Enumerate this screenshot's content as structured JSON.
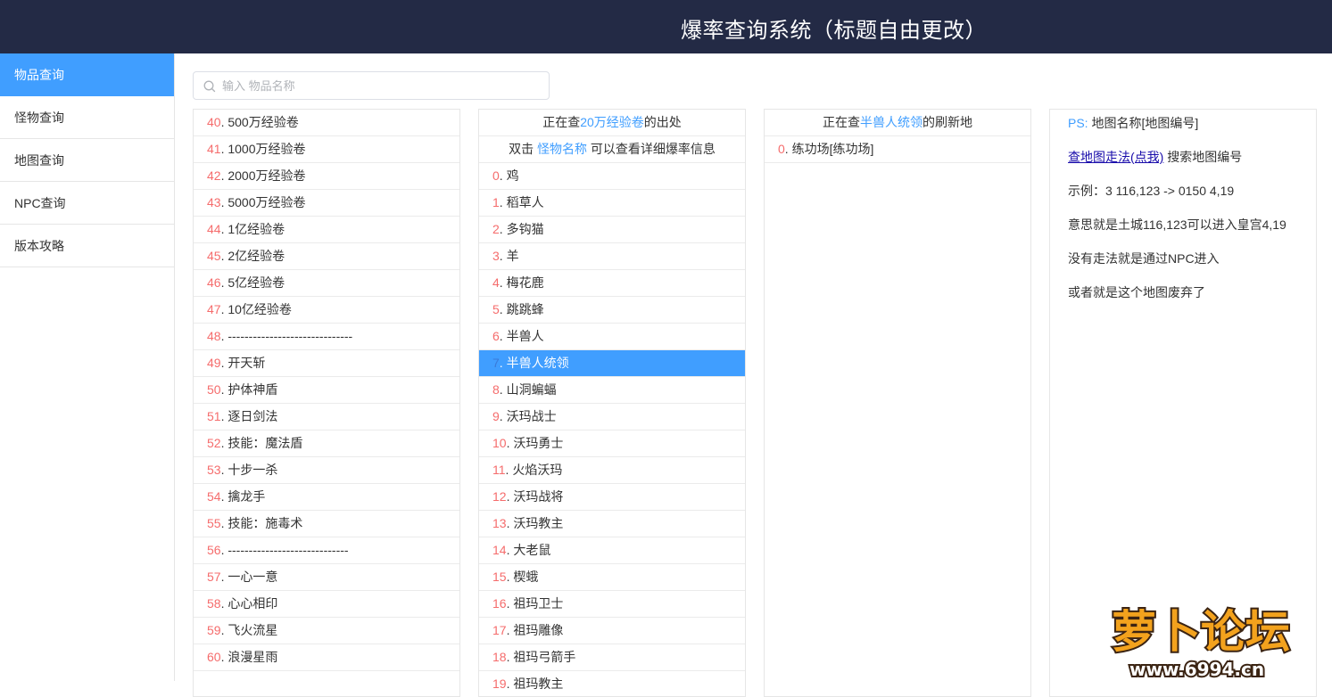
{
  "header": {
    "title": "爆率查询系统（标题自由更改）"
  },
  "sidebar": {
    "items": [
      {
        "label": "物品查询",
        "active": true
      },
      {
        "label": "怪物查询",
        "active": false
      },
      {
        "label": "地图查询",
        "active": false
      },
      {
        "label": "NPC查询",
        "active": false
      },
      {
        "label": "版本攻略",
        "active": false
      }
    ]
  },
  "search": {
    "placeholder": "输入 物品名称",
    "value": ""
  },
  "items_list": [
    {
      "idx": "40",
      "name": "500万经验卷"
    },
    {
      "idx": "41",
      "name": "1000万经验卷"
    },
    {
      "idx": "42",
      "name": "2000万经验卷"
    },
    {
      "idx": "43",
      "name": "5000万经验卷"
    },
    {
      "idx": "44",
      "name": "1亿经验卷"
    },
    {
      "idx": "45",
      "name": "2亿经验卷"
    },
    {
      "idx": "46",
      "name": "5亿经验卷"
    },
    {
      "idx": "47",
      "name": "10亿经验卷"
    },
    {
      "idx": "48",
      "name": "------------------------------"
    },
    {
      "idx": "49",
      "name": "开天斩"
    },
    {
      "idx": "50",
      "name": "护体神盾"
    },
    {
      "idx": "51",
      "name": "逐日剑法"
    },
    {
      "idx": "52",
      "name": "技能：魔法盾"
    },
    {
      "idx": "53",
      "name": "十步一杀"
    },
    {
      "idx": "54",
      "name": "擒龙手"
    },
    {
      "idx": "55",
      "name": "技能：施毒术"
    },
    {
      "idx": "56",
      "name": "-----------------------------"
    },
    {
      "idx": "57",
      "name": "一心一意"
    },
    {
      "idx": "58",
      "name": "心心相印"
    },
    {
      "idx": "59",
      "name": "飞火流星"
    },
    {
      "idx": "60",
      "name": "浪漫星雨"
    }
  ],
  "monster_panel": {
    "header_prefix": "正在查",
    "header_item": "20万经验卷",
    "header_suffix": "的出处",
    "hint_prefix": "双击",
    "hint_link": "怪物名称",
    "hint_suffix": "可以查看详细爆率信息",
    "selected_index": 7,
    "monsters": [
      {
        "idx": "0",
        "name": "鸡"
      },
      {
        "idx": "1",
        "name": "稻草人"
      },
      {
        "idx": "2",
        "name": "多钩猫"
      },
      {
        "idx": "3",
        "name": "羊"
      },
      {
        "idx": "4",
        "name": "梅花鹿"
      },
      {
        "idx": "5",
        "name": "跳跳蜂"
      },
      {
        "idx": "6",
        "name": "半兽人"
      },
      {
        "idx": "7",
        "name": "半兽人统领"
      },
      {
        "idx": "8",
        "name": "山洞蝙蝠"
      },
      {
        "idx": "9",
        "name": "沃玛战士"
      },
      {
        "idx": "10",
        "name": "沃玛勇士"
      },
      {
        "idx": "11",
        "name": "火焰沃玛"
      },
      {
        "idx": "12",
        "name": "沃玛战将"
      },
      {
        "idx": "13",
        "name": "沃玛教主"
      },
      {
        "idx": "14",
        "name": "大老鼠"
      },
      {
        "idx": "15",
        "name": "楔蛾"
      },
      {
        "idx": "16",
        "name": "祖玛卫士"
      },
      {
        "idx": "17",
        "name": "祖玛雕像"
      },
      {
        "idx": "18",
        "name": "祖玛弓箭手"
      },
      {
        "idx": "19",
        "name": "祖玛教主"
      }
    ]
  },
  "map_panel": {
    "header_prefix": "正在查",
    "header_monster": "半兽人统领",
    "header_suffix": "的刷新地",
    "maps": [
      {
        "idx": "0",
        "name": "练功场[练功场]"
      }
    ]
  },
  "notes": {
    "ps_label": "PS:",
    "ps_text": "地图名称[地图编号]",
    "link_text": "查地图走法(点我)",
    "link_suffix": "搜索地图编号",
    "example": "示例：3 116,123 -> 0150 4,19",
    "meaning": "意思就是土城116,123可以进入皇宫4,19",
    "no_route": "没有走法就是通过NPC进入",
    "abandoned": "或者就是这个地图废弃了"
  },
  "watermark": {
    "text_main": "萝卜论坛",
    "text_url": "www.6994.cn"
  },
  "colors": {
    "header_bg": "#232a45",
    "accent": "#409eff",
    "index_red": "#f56c6c",
    "link": "#1a0dab"
  }
}
